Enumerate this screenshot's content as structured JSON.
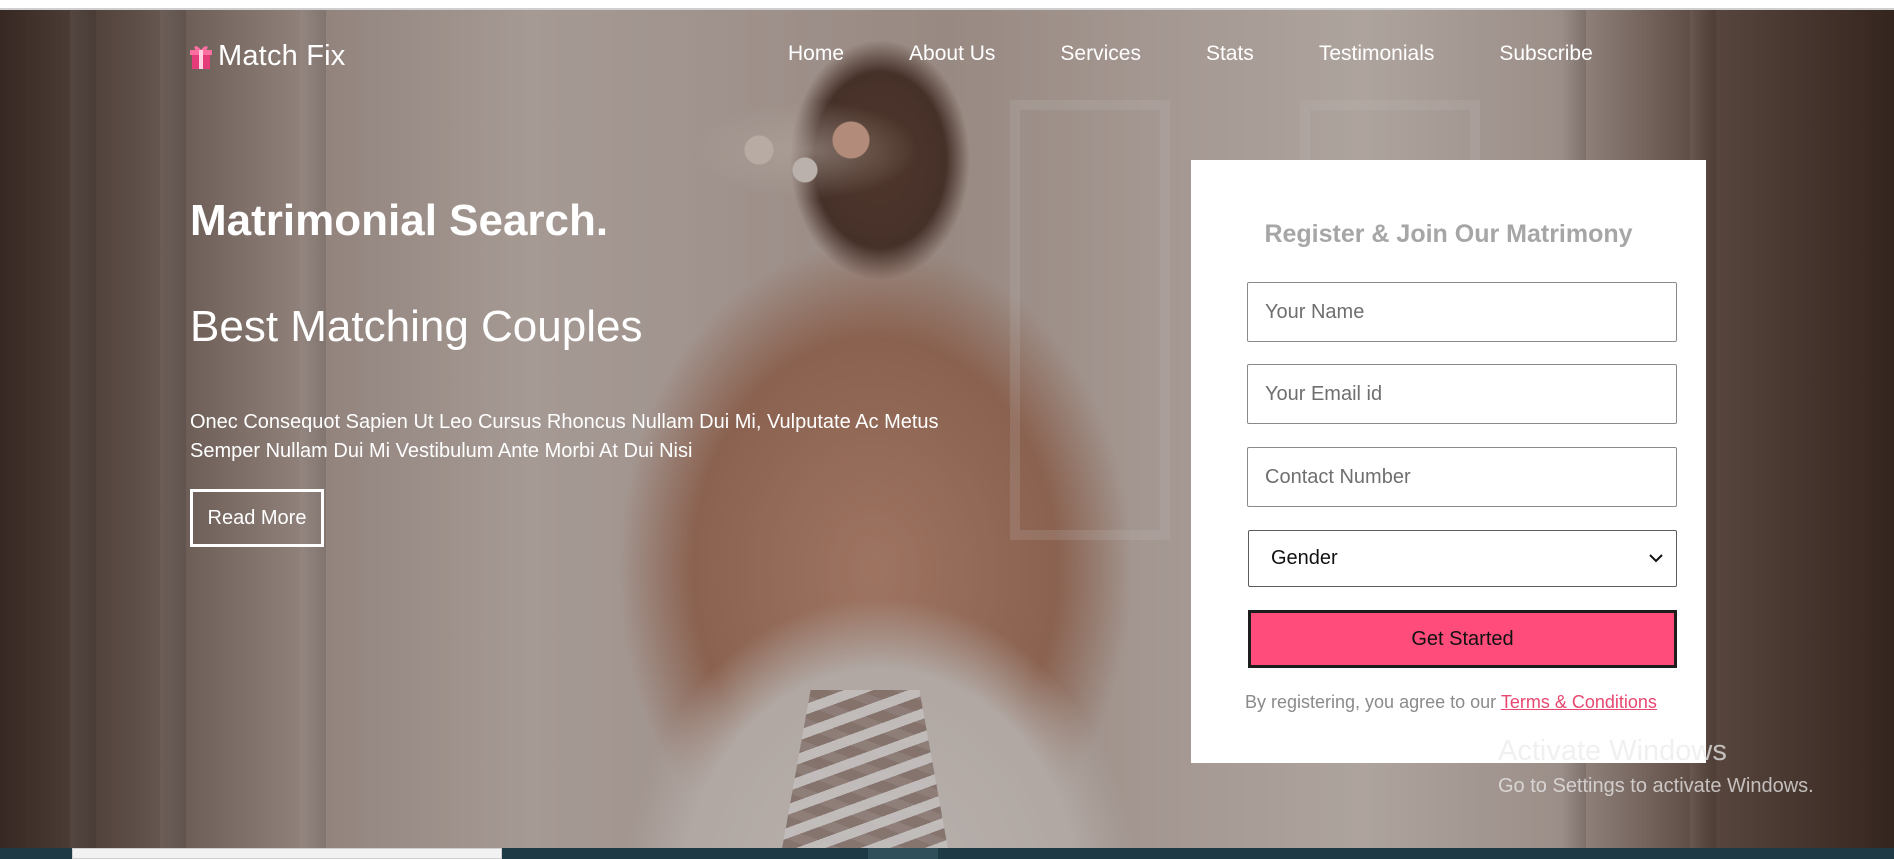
{
  "brand": {
    "name": "Match Fix",
    "icon": "gift-icon",
    "icon_color": "#e63b79"
  },
  "nav": {
    "items": [
      {
        "label": "Home"
      },
      {
        "label": "About Us"
      },
      {
        "label": "Services"
      },
      {
        "label": "Stats"
      },
      {
        "label": "Testimonials"
      },
      {
        "label": "Subscribe"
      }
    ]
  },
  "hero": {
    "title": "Matrimonial Search.",
    "subtitle": "Best Matching Couples",
    "description": "Onec Consequot Sapien Ut Leo Cursus Rhoncus Nullam Dui Mi, Vulputate Ac Metus Semper Nullam Dui Mi Vestibulum Ante Morbi At Dui Nisi",
    "read_more_label": "Read More"
  },
  "form": {
    "title": "Register & Join Our Matrimony",
    "name_placeholder": "Your Name",
    "email_placeholder": "Your Email id",
    "contact_placeholder": "Contact Number",
    "gender_selected": "Gender",
    "submit_label": "Get Started",
    "terms_prefix": "By registering, you agree to our",
    "terms_link": "Terms & Conditions",
    "accent_color": "#ff4c7a"
  },
  "watermark": {
    "title": "Activate Windows",
    "subtitle": "Go to Settings to activate Windows."
  }
}
